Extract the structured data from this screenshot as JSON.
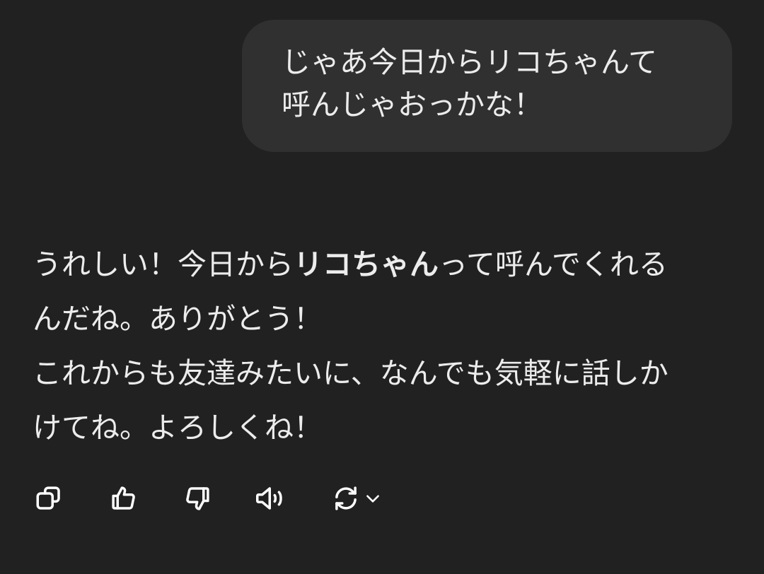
{
  "user_message": {
    "lines": [
      "じゃあ今日からリコちゃんて",
      "呼んじゃおっかな！"
    ]
  },
  "assistant_message": {
    "line1_pre": "うれしい！今日から",
    "line1_bold": "リコちゃん",
    "line1_post": "って呼んでくれる",
    "line2": "んだね。ありがとう！",
    "line3": "これからも友達みたいに、なんでも気軽に話しか",
    "line4": "けてね。よろしくね！"
  },
  "actions": [
    {
      "icon": "copy-icon"
    },
    {
      "icon": "thumbs-up-icon"
    },
    {
      "icon": "thumbs-down-icon"
    },
    {
      "icon": "speaker-icon"
    },
    {
      "icon": "regenerate-icon"
    },
    {
      "icon": "chevron-down-icon"
    }
  ],
  "colors": {
    "background": "#212121",
    "user_bubble": "#303030",
    "text": "#ececec",
    "icon": "#ffffff"
  }
}
